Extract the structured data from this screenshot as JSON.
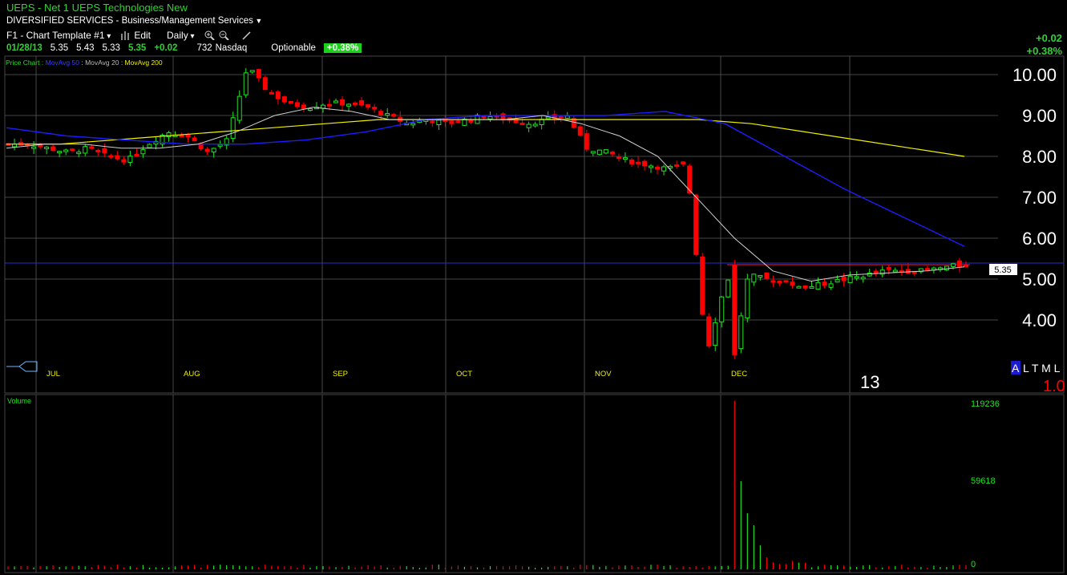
{
  "header": {
    "title": "UEPS - Net 1 UEPS Technologies New",
    "sector": "DIVERSIFIED SERVICES - Business/Management Services",
    "template": "F1 - Chart Template #1",
    "edit_label": "Edit",
    "period": "Daily"
  },
  "quote": {
    "date": "01/28/13",
    "open": "5.35",
    "high": "5.43",
    "low": "5.33",
    "close": "5.35",
    "change": "+0.02",
    "volume": "732",
    "exchange": "Nasdaq",
    "optionable": "Optionable",
    "pct_change": "+0.38%"
  },
  "right_change": {
    "change": "+0.02",
    "pct": "+0.38%"
  },
  "legend": {
    "price": "Price Chart",
    "ma50": "MovAvg 50",
    "ma20": "MovAvg 20",
    "ma200": "MovAvg 200"
  },
  "price_axis": [
    "10.00",
    "9.00",
    "8.00",
    "7.00",
    "6.00",
    "5.00",
    "4.00"
  ],
  "price_axis_values": [
    10,
    9,
    8,
    7,
    6,
    5,
    4
  ],
  "months": [
    "JUL",
    "AUG",
    "SEP",
    "OCT",
    "NOV",
    "DEC"
  ],
  "year_label": "13",
  "last_price": "5.35",
  "rating": {
    "a": "A",
    "rest": "L T M L",
    "value": "1.0"
  },
  "volume_panel": {
    "label": "Volume",
    "ticks": [
      "119236",
      "59618",
      "0"
    ]
  },
  "colors": {
    "up": "#1ee31e",
    "down": "#ff0000",
    "ma50": "#1c1cff",
    "ma20": "#cfcfcf",
    "ma200": "#f0f000",
    "grid": "#5a5a5a",
    "hline": "#2a2ad6"
  },
  "chart_data": {
    "type": "candlestick",
    "series": [
      {
        "name": "Price Chart"
      },
      {
        "name": "MovAvg 50"
      },
      {
        "name": "MovAvg 20"
      },
      {
        "name": "MovAvg 200"
      }
    ],
    "period": "Daily",
    "ylim": [
      3.0,
      10.5
    ],
    "last_close": 5.35,
    "approx_close_path": [
      8.3,
      8.3,
      8.2,
      8.1,
      8.2,
      8.0,
      7.9,
      8.3,
      8.6,
      8.5,
      8.1,
      8.4,
      10.2,
      9.6,
      9.3,
      9.2,
      9.3,
      9.3,
      9.2,
      9.0,
      8.8,
      8.9,
      8.8,
      8.9,
      9.0,
      8.9,
      8.8,
      8.9,
      9.0,
      8.2,
      8.1,
      7.9,
      7.8,
      7.7,
      7.8,
      3.2,
      5.0,
      5.1,
      5.0,
      4.9,
      4.8,
      4.9,
      5.0,
      5.1,
      5.2,
      5.2,
      5.2,
      5.3,
      5.35
    ],
    "ma200_path": [
      8.3,
      8.3,
      8.4,
      8.5,
      8.6,
      8.7,
      8.8,
      8.9,
      8.9,
      8.9,
      8.9,
      8.9,
      8.9,
      8.9,
      8.8,
      8.6,
      8.4,
      8.2,
      8.0
    ],
    "ma50_path": [
      8.7,
      8.5,
      8.4,
      8.3,
      8.3,
      8.4,
      8.6,
      8.9,
      9.0,
      9.0,
      9.0,
      9.1,
      8.8,
      8.0,
      7.2,
      6.5,
      5.8
    ],
    "volume_max": 119236
  }
}
